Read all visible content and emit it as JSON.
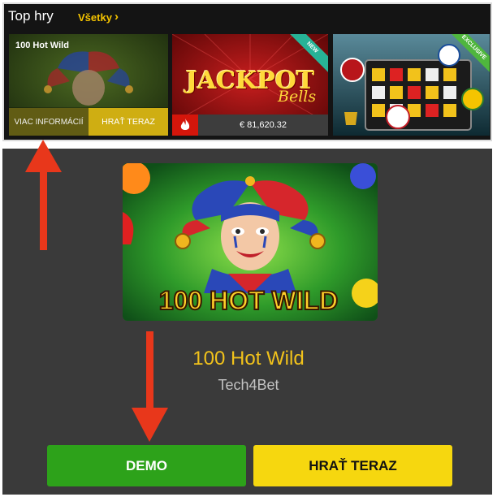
{
  "top_section": {
    "title": "Top hry",
    "see_all_label": "Všetky",
    "see_all_icon": "chevron-right-icon",
    "tiles": [
      {
        "name": "100 Hot Wild",
        "info_label": "VIAC INFORMÁCIÍ",
        "play_label": "HRAŤ TERAZ"
      },
      {
        "logo_text": "JACKPOT",
        "logo_sub": "Bells",
        "badge": "NEW",
        "jackpot_amount": "€ 81,620.32",
        "icon": "fire-icon"
      },
      {
        "badge": "EXCLUSIVE"
      }
    ]
  },
  "main": {
    "hero_title": "100 HOT WILD",
    "game_name": "100 Hot Wild",
    "provider": "Tech4Bet",
    "demo_label": "DEMO",
    "play_label": "HRAŤ TERAZ"
  },
  "colors": {
    "accent_yellow": "#f5c400",
    "demo_green": "#2da21a",
    "play_yellow": "#f6d70f",
    "arrow_red": "#e8371b",
    "panel_bg": "#141414",
    "lower_bg": "#3a3a3a"
  }
}
